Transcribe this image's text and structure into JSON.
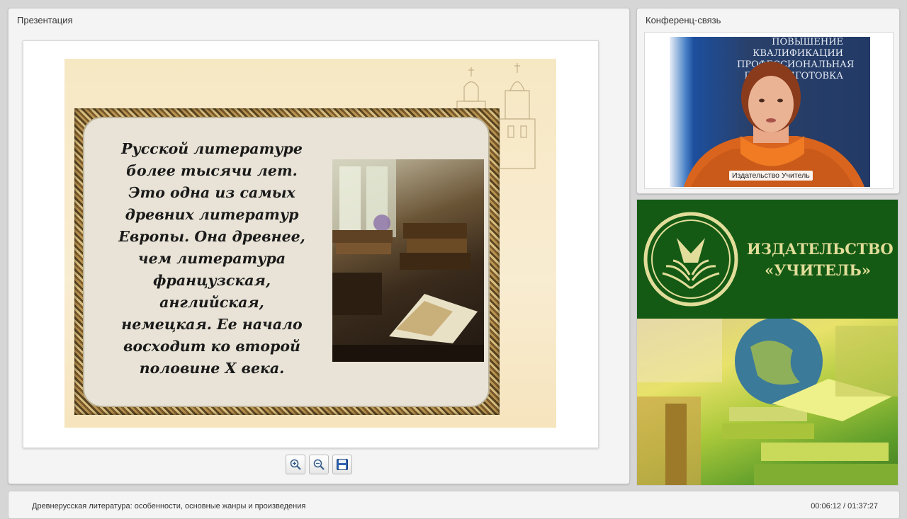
{
  "presentation": {
    "title": "Презентация",
    "slide_text": "Русской литературе\nболее тысячи лет.\nЭто одна из самых\nдревних литератур\nЕвропы. Она древнее,\nчем литература\nфранцузская,\nанглийская,\nнемецкая. Ее начало\nвосходит ко второй\nполовине X века.",
    "toolbar": {
      "zoom_in_icon": "zoom-in-icon",
      "zoom_out_icon": "zoom-out-icon",
      "save_icon": "floppy-disk-icon"
    }
  },
  "conference": {
    "title": "Конференц-связь",
    "banner_text": "ПОВЫШЕНИЕ\nКВАЛИФИКАЦИИ\nПРОФЕССИОНАЛЬНАЯ\nПЕРЕПОДГОТОВКА",
    "speaker_name": "Издательство Учитель"
  },
  "publisher": {
    "name": "ИЗДАТЕЛЬСТВО\n«УЧИТЕЛЬ»",
    "brand_green": "#145a14",
    "brand_gold": "#e2dd9a"
  },
  "bottom_bar": {
    "lecture_title": "Древнерусская литература: особенности, основные жанры и произведения",
    "time": "00:06:12 / 01:37:27"
  }
}
